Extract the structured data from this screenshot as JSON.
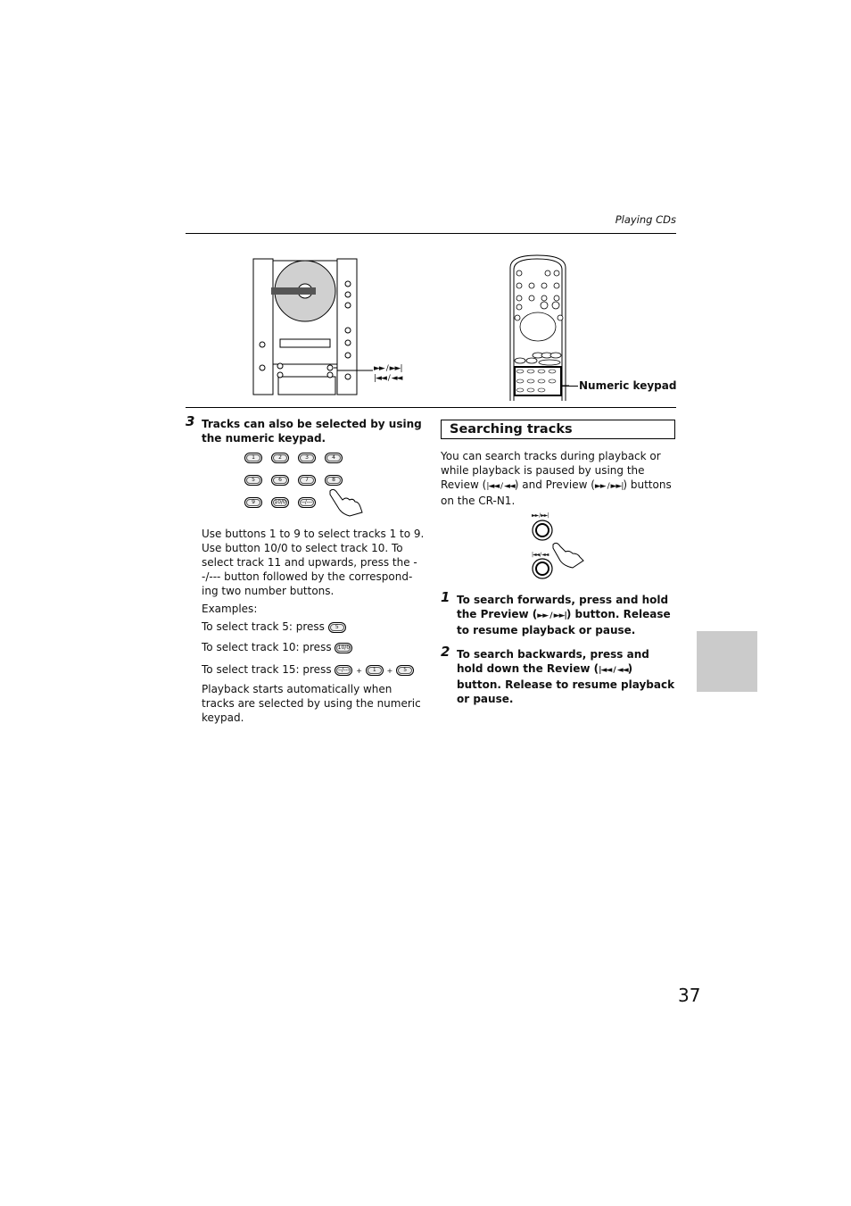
{
  "header": {
    "section_title": "Playing CDs"
  },
  "figures": {
    "unit_callout": {
      "forward": "►► / ►►|",
      "back": "|◄◄ / ◄◄"
    },
    "remote_callout": "Numeric keypad",
    "keypad_keys": [
      "1",
      "2",
      "3",
      "4",
      "5",
      "6",
      "7",
      "8",
      "9",
      "10/0",
      "--/---"
    ],
    "search_buttons": {
      "top_label": "►► / ►►|",
      "bottom_label": "|◄◄ / ◄◄"
    }
  },
  "left_column": {
    "step3": {
      "number": "3",
      "heading": "Tracks can also be selected by using the numeric keypad."
    },
    "paragraph": "Use buttons 1 to 9 to select tracks 1 to 9. Use button 10/0 to select track 10. To select track 11 and upwards, press the --/--- button followed by the correspond-ing two number buttons.",
    "examples_label": "Examples:",
    "examples": [
      {
        "text": "To select track 5: press",
        "keys": [
          "5"
        ]
      },
      {
        "text": "To select track 10: press",
        "keys": [
          "10/0"
        ]
      },
      {
        "text": "To select track 15: press",
        "keys": [
          "--/---",
          "1",
          "5"
        ]
      }
    ],
    "closing": "Playback starts automatically when tracks are selected by using the numeric keypad."
  },
  "right_column": {
    "section_title": "Searching tracks",
    "intro_a": "You can search tracks during playback or while playback is paused by using the Review (",
    "review_glyph": "|◄◄ / ◄◄",
    "intro_b": ") and Preview (",
    "preview_glyph": "►► / ►►|",
    "intro_c": ") buttons on the CR-N1.",
    "steps": [
      {
        "number": "1",
        "text_a": "To search forwards, press and hold the Preview (",
        "glyph": "►► / ►►|",
        "text_b": ") button. Release to resume playback or pause."
      },
      {
        "number": "2",
        "text_a": "To search backwards, press and hold down the Review (",
        "glyph": "|◄◄ / ◄◄",
        "text_b": ") button. Release to resume playback or pause."
      }
    ]
  },
  "page_number": "37"
}
